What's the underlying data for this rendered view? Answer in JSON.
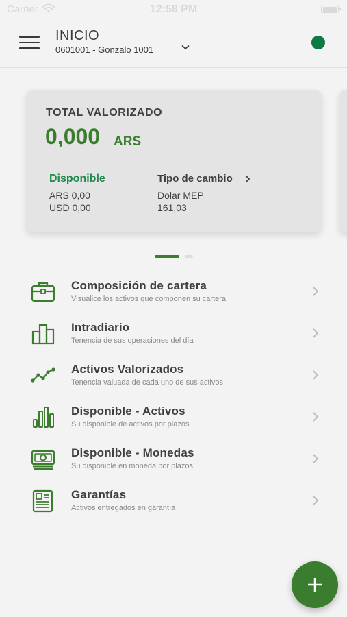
{
  "status_bar": {
    "carrier": "Carrier",
    "time": "12:58 PM"
  },
  "header": {
    "title": "INICIO",
    "account": "0601001 - Gonzalo 1001",
    "status_color": "#0b7a43"
  },
  "summary_card": {
    "title": "TOTAL VALORIZADO",
    "total": "0,000",
    "currency": "ARS",
    "disponible": {
      "label": "Disponible",
      "ars": "ARS 0,00",
      "usd": "USD 0,00"
    },
    "tipo_cambio": {
      "label": "Tipo de cambio",
      "name": "Dolar MEP",
      "value": "161,03"
    }
  },
  "pager": {
    "pages": 2,
    "active": 1
  },
  "menu_items": [
    {
      "title": "Composición de cartera",
      "subtitle": "Visualice los activos que componen su cartera",
      "icon": "briefcase-icon"
    },
    {
      "title": "Intradiario",
      "subtitle": "Tenencia de sus operaciones del día",
      "icon": "bar-blocks-icon"
    },
    {
      "title": "Activos Valorizados",
      "subtitle": "Tenencia valuada de cada uno de sus activos",
      "icon": "trend-line-icon"
    },
    {
      "title": "Disponible - Activos",
      "subtitle": "Su disponible de activos por plazos",
      "icon": "bar-chart-icon"
    },
    {
      "title": "Disponible - Monedas",
      "subtitle": "Su disponible en moneda por plazos",
      "icon": "banknote-icon"
    },
    {
      "title": "Garantías",
      "subtitle": "Activos entregados en garantía",
      "icon": "document-icon"
    }
  ],
  "colors": {
    "brand_green": "#3b7d2e",
    "accent_green": "#1f8a4c",
    "background": "#f3f3f3",
    "card": "#e4e4e4"
  },
  "fab": {
    "icon": "plus-icon"
  }
}
